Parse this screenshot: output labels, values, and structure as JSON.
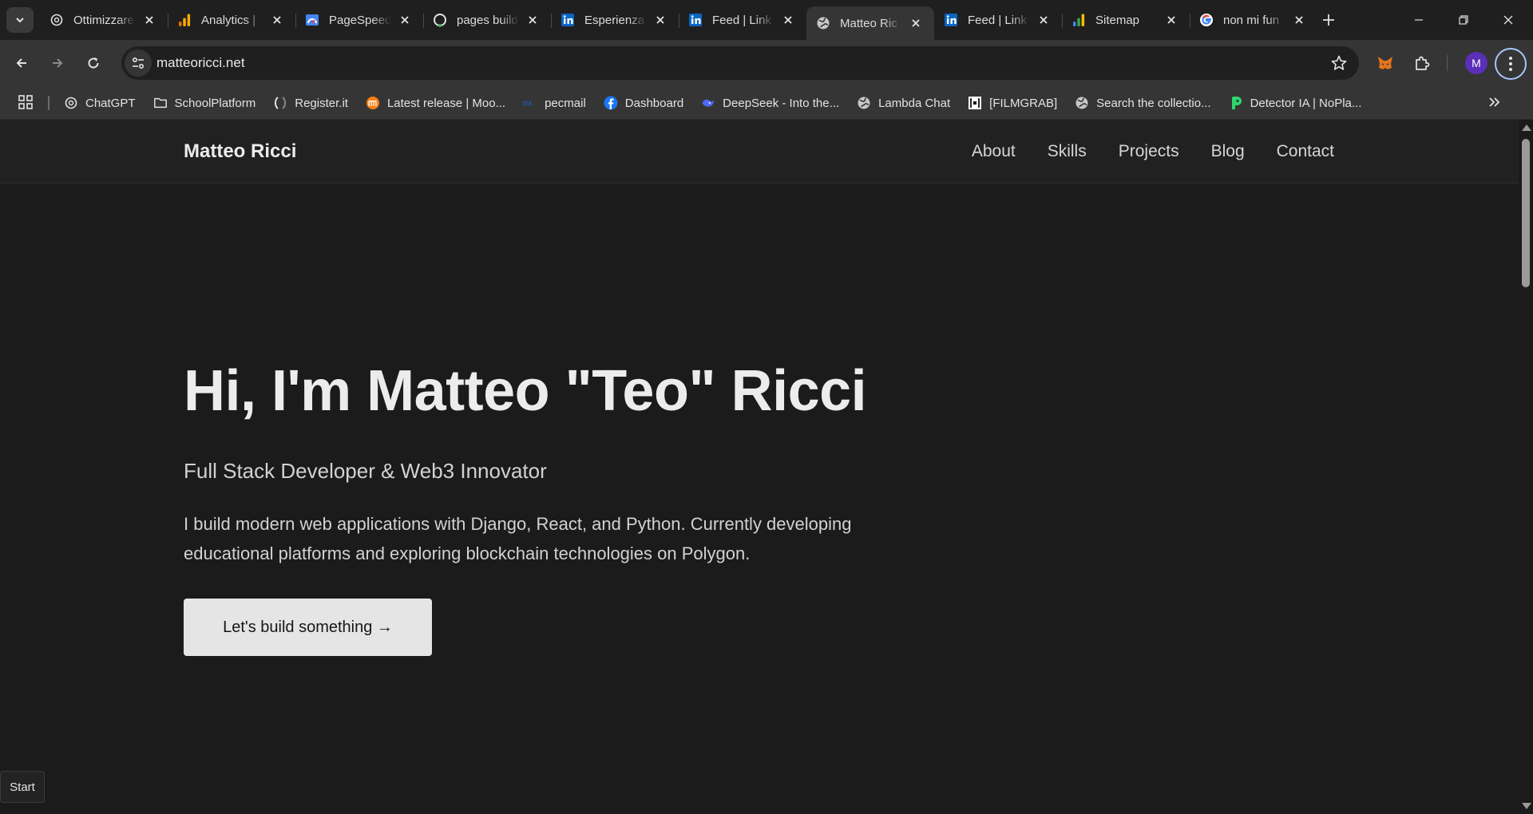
{
  "tabs": [
    {
      "title": "Ottimizzare",
      "icon": "openai-icon",
      "active": false
    },
    {
      "title": "Analytics |",
      "icon": "analytics-icon",
      "active": false
    },
    {
      "title": "PageSpeed",
      "icon": "pagespeed-icon",
      "active": false
    },
    {
      "title": "pages build",
      "icon": "github-icon",
      "active": false
    },
    {
      "title": "Esperienza",
      "icon": "linkedin-icon",
      "active": false
    },
    {
      "title": "Feed | Link",
      "icon": "linkedin-icon",
      "active": false
    },
    {
      "title": "Matteo Ric",
      "icon": "globe-icon",
      "active": true
    },
    {
      "title": "Feed | Link",
      "icon": "linkedin-icon",
      "active": false
    },
    {
      "title": "Sitemap",
      "icon": "analytics-icon",
      "active": false
    },
    {
      "title": "non mi fun",
      "icon": "google-icon",
      "active": false
    }
  ],
  "toolbar": {
    "url": "matteoricci.net",
    "avatar_letter": "M"
  },
  "bookmarks": [
    {
      "label": "ChatGPT",
      "icon": "openai-icon"
    },
    {
      "label": "SchoolPlatform",
      "icon": "folder-icon"
    },
    {
      "label": "Register.it",
      "icon": "register-icon"
    },
    {
      "label": "Latest release | Moo...",
      "icon": "moodle-icon"
    },
    {
      "label": "pecmail",
      "icon": "pecmail-icon"
    },
    {
      "label": "Dashboard",
      "icon": "facebook-icon"
    },
    {
      "label": "DeepSeek - Into the...",
      "icon": "deepseek-icon"
    },
    {
      "label": "Lambda Chat",
      "icon": "globe-icon"
    },
    {
      "label": "[FILMGRAB]",
      "icon": "filmgrab-icon"
    },
    {
      "label": "Search the collectio...",
      "icon": "globe-icon"
    },
    {
      "label": "Detector IA | NoPla...",
      "icon": "detector-icon"
    }
  ],
  "site": {
    "brand": "Matteo Ricci",
    "nav": [
      "About",
      "Skills",
      "Projects",
      "Blog",
      "Contact"
    ],
    "hero_title": "Hi, I'm Matteo \"Teo\" Ricci",
    "hero_subtitle": "Full Stack Developer & Web3 Innovator",
    "hero_text": "I build modern web applications with Django, React, and Python. Currently developing educational platforms and exploring blockchain technologies on Polygon.",
    "cta_label": "Let's build something →"
  },
  "taskbar": {
    "start_label": "Start"
  }
}
